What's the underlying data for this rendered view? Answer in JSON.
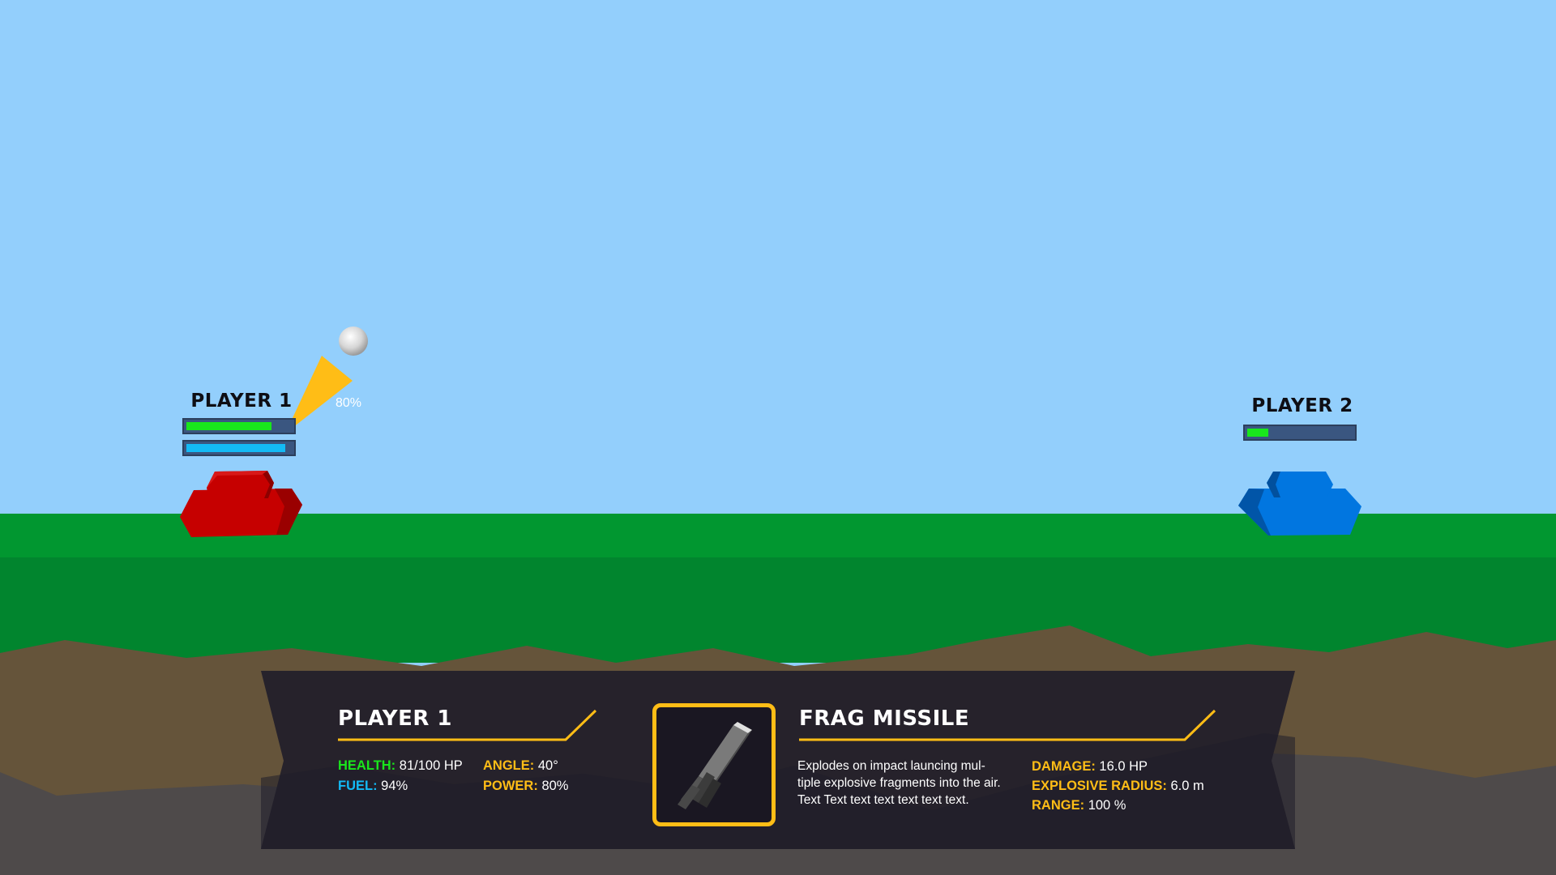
{
  "scene": {
    "colors": {
      "sky": "#93cffc",
      "grass_top": "#019730",
      "grass_bottom": "#01852e",
      "dirt": "#65543a",
      "rock": "#4e4a4a",
      "player1_tank": "#c10000",
      "player2_tank": "#0176e0",
      "aim_cone": "#ffbd16"
    },
    "projectile_icon": "cannonball-icon",
    "aim_power_label": "80%"
  },
  "player1": {
    "name": "PLAYER 1",
    "health_fraction": 0.81,
    "fuel_fraction": 0.94
  },
  "player2": {
    "name": "PLAYER 2",
    "health_fraction": 0.2
  },
  "hud": {
    "player_title": "PLAYER 1",
    "health_key": "HEALTH:",
    "health_val": "81/100 HP",
    "fuel_key": "FUEL:",
    "fuel_val": "94%",
    "angle_key": "ANGLE:",
    "angle_val": "40°",
    "power_key": "POWER:",
    "power_val": "80%",
    "weapon_icon": "frag-missile-icon",
    "weapon_title": "FRAG MISSILE",
    "weapon_desc": "Explodes on impact launcing mul-tiple explosive fragments into the air. Text Text text text text text text.",
    "damage_key": "DAMAGE:",
    "damage_val": "16.0 HP",
    "radius_key": "EXPLOSIVE RADIUS:",
    "radius_val": "6.0 m",
    "range_key": "RANGE:",
    "range_val": "100 %",
    "accent": "#ffbd16"
  }
}
